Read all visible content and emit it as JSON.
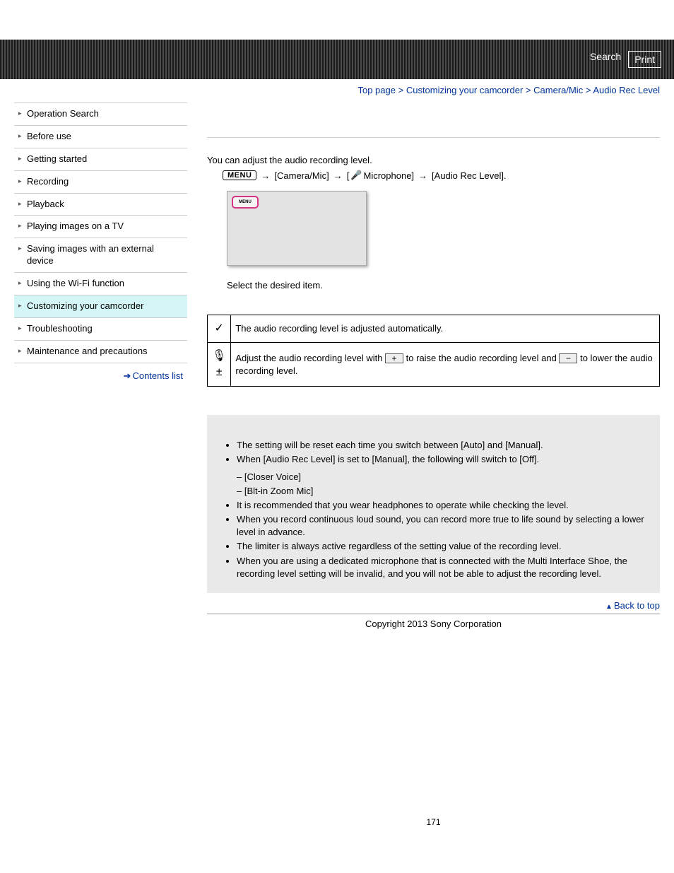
{
  "header": {
    "search": "Search",
    "print": "Print"
  },
  "breadcrumb": {
    "top": "Top page",
    "l1": "Customizing your camcorder",
    "l2": "Camera/Mic",
    "current": "Audio Rec Level"
  },
  "sidebar": {
    "items": [
      "Operation Search",
      "Before use",
      "Getting started",
      "Recording",
      "Playback",
      "Playing images on a TV",
      "Saving images with an external device",
      "Using the Wi-Fi function",
      "Customizing your camcorder",
      "Troubleshooting",
      "Maintenance and precautions"
    ],
    "active_index": 8,
    "contents_list": "Contents list"
  },
  "main": {
    "title": " ",
    "intro": "You can adjust the audio recording level.",
    "menu_label": "MENU",
    "path_cam": "[Camera/Mic]",
    "path_mic": "Microphone]",
    "path_arl": "[Audio Rec Level].",
    "mock_label": "MENU",
    "select_item": "Select the desired item.",
    "table": {
      "row1": {
        "icon": "✓",
        "text": "The audio recording level is adjusted automatically."
      },
      "row2": {
        "pre": "Adjust the audio recording level with ",
        "mid": " to raise the audio recording level and ",
        "post": " to lower the audio recording level."
      }
    },
    "notes_title": " ",
    "notes": [
      "The setting will be reset each time you switch between [Auto] and [Manual].",
      "When [Audio Rec Level] is set to [Manual], the following will switch to [Off].",
      "It is recommended that you wear headphones to operate while checking the level.",
      "When you record continuous loud sound, you can record more true to life sound by selecting a lower level in advance.",
      "The limiter is always active regardless of the setting value of the recording level.",
      "When you are using a dedicated microphone that is connected with the Multi Interface Shoe, the recording level setting will be invalid, and you will not be able to adjust the recording level."
    ],
    "sub_notes": [
      "[Closer Voice]",
      "[Blt-in Zoom Mic]"
    ],
    "back_to_top": "Back to top",
    "copyright": "Copyright 2013 Sony Corporation",
    "page_number": "171"
  }
}
